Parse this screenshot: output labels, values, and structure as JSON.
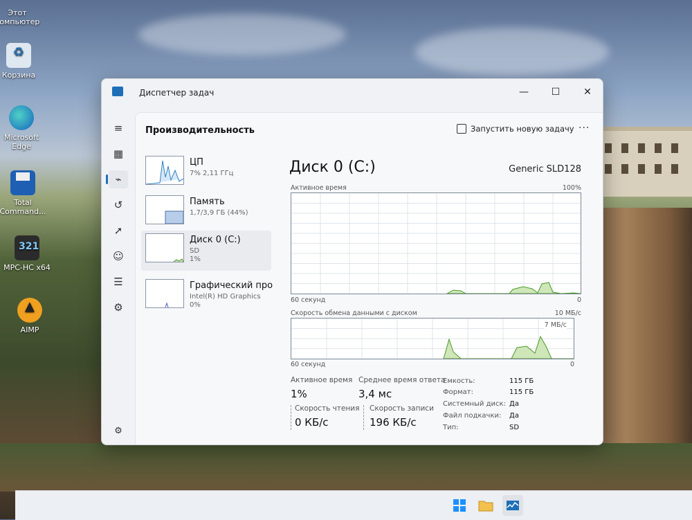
{
  "desktop": {
    "icons": [
      {
        "label": "Этот компьютер"
      },
      {
        "label": "Корзина"
      },
      {
        "label": "Microsoft Edge"
      },
      {
        "label": "Total Command..."
      },
      {
        "label": "MPC-HC x64"
      },
      {
        "label": "AIMP"
      }
    ]
  },
  "window": {
    "title": "Диспетчер задач",
    "controls": {
      "minimize": "—",
      "maximize": "☐",
      "close": "✕"
    }
  },
  "nav": {
    "items": [
      {
        "icon": "menu-icon",
        "glyph": "≡"
      },
      {
        "icon": "processes-icon",
        "glyph": "▦"
      },
      {
        "icon": "performance-icon",
        "glyph": "⌁"
      },
      {
        "icon": "app-history-icon",
        "glyph": "↺"
      },
      {
        "icon": "startup-icon",
        "glyph": "➚"
      },
      {
        "icon": "users-icon",
        "glyph": "☺"
      },
      {
        "icon": "details-icon",
        "glyph": "☰"
      },
      {
        "icon": "services-icon",
        "glyph": "⚙"
      }
    ],
    "settings_glyph": "⚙"
  },
  "header": {
    "title": "Производительность",
    "run_task": "Запустить новую задачу",
    "more": "···"
  },
  "devices": [
    {
      "name": "ЦП",
      "sub": "7% 2,11 ГГц",
      "sub2": ""
    },
    {
      "name": "Память",
      "sub": "1,7/3,9 ГБ (44%)",
      "sub2": ""
    },
    {
      "name": "Диск 0 (C:)",
      "sub": "SD",
      "sub2": "1%"
    },
    {
      "name": "Графический про",
      "sub": "Intel(R) HD Graphics",
      "sub2": "0%"
    }
  ],
  "detail": {
    "title": "Диск 0 (C:)",
    "model": "Generic SLD128",
    "graph1": {
      "label": "Активное время",
      "max": "100%",
      "xlabel": "60 секунд",
      "xmin": "0"
    },
    "graph2": {
      "label": "Скорость обмена данными с диском",
      "max": "10 МБ/с",
      "inner_max": "7 МБ/с",
      "xlabel": "60 секунд",
      "xmin": "0"
    },
    "stats": {
      "active_time_label": "Активное время",
      "active_time_value": "1%",
      "avg_response_label": "Среднее время ответа",
      "avg_response_value": "3,4 мс",
      "read_speed_label": "Скорость чтения",
      "read_speed_value": "0 КБ/с",
      "write_speed_label": "Скорость записи",
      "write_speed_value": "196 КБ/с"
    },
    "props": [
      {
        "k": "Емкость:",
        "v": "115 ГБ"
      },
      {
        "k": "Формат:",
        "v": "115 ГБ"
      },
      {
        "k": "Системный диск:",
        "v": "Да"
      },
      {
        "k": "Файл подкачки:",
        "v": "Да"
      },
      {
        "k": "Тип:",
        "v": "SD"
      }
    ]
  },
  "colors": {
    "accent": "#1e6fb8",
    "disk_graph": "#4c9a2a",
    "disk_fill": "#cfe6b8"
  }
}
